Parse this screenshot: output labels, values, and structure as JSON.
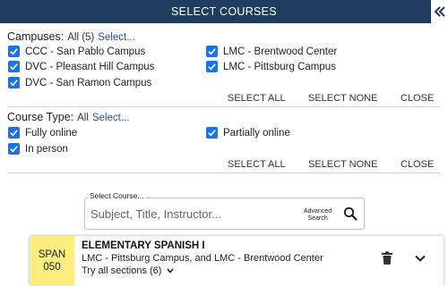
{
  "header": {
    "title": "SELECT COURSES",
    "collapse_icon": "double-chevron-left-icon"
  },
  "campuses": {
    "label": "Campuses:",
    "count": "All (5)",
    "select_link": "Select...",
    "items": [
      {
        "label": "CCC - San Pablo Campus",
        "checked": true
      },
      {
        "label": "DVC - Pleasant Hill Campus",
        "checked": true
      },
      {
        "label": "DVC - San Ramon Campus",
        "checked": true
      },
      {
        "label": "LMC - Brentwood Center",
        "checked": true
      },
      {
        "label": "LMC - Pittsburg Campus",
        "checked": true
      }
    ],
    "actions": {
      "select_all": "SELECT ALL",
      "select_none": "SELECT NONE",
      "close": "CLOSE"
    }
  },
  "course_type": {
    "label": "Course Type:",
    "count": "All",
    "select_link": "Select...",
    "items": [
      {
        "label": "Fully online",
        "checked": true
      },
      {
        "label": "In person",
        "checked": true
      },
      {
        "label": "Partially online",
        "checked": true
      }
    ],
    "actions": {
      "select_all": "SELECT ALL",
      "select_none": "SELECT NONE",
      "close": "CLOSE"
    }
  },
  "search": {
    "legend": "Select Course...",
    "placeholder": "Subject, Title, Instructor...",
    "advanced_line1": "Advanced",
    "advanced_line2": "Search"
  },
  "course": {
    "subject": "SPAN",
    "number": "050",
    "title": "ELEMENTARY SPANISH I",
    "campuses": "LMC - Pittsburg Campus, and LMC - Brentwood Center",
    "sections": "Try all sections (6)"
  },
  "colors": {
    "header_bg": "#1f3d5e",
    "checkbox": "#1a73e8",
    "course_code_bg": "#fbee7f",
    "link": "#2b4f9a"
  }
}
